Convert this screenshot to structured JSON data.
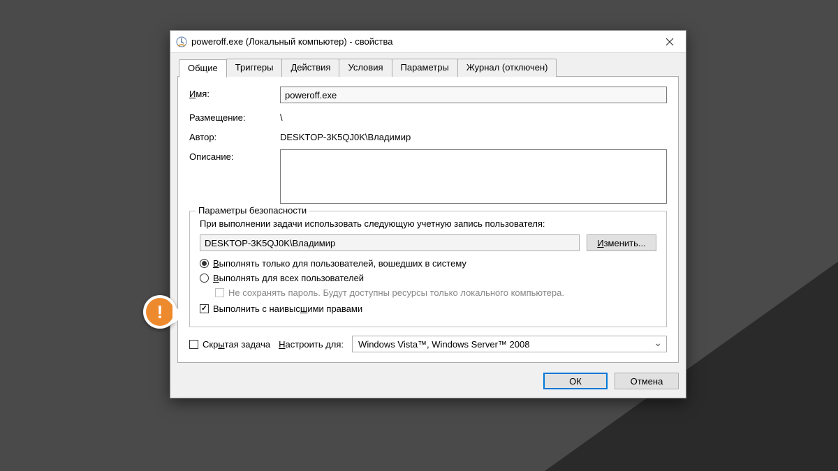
{
  "titlebar": {
    "title": "poweroff.exe (Локальный компьютер) - свойства"
  },
  "tabs": {
    "general": "Общие",
    "triggers": "Триггеры",
    "actions": "Действия",
    "conditions": "Условия",
    "settings": "Параметры",
    "history": "Журнал (отключен)"
  },
  "general": {
    "name_label": "И",
    "name_label2": "мя:",
    "name_value": "poweroff.exe",
    "location_label": "Размещение:",
    "location_value": "\\",
    "author_label": "Автор:",
    "author_value": "DESKTOP-3K5QJ0K\\Владимир",
    "description_label": "Описание:",
    "description_value": ""
  },
  "security": {
    "legend": "Параметры безопасности",
    "run_as_label": "При выполнении задачи использовать следующую учетную запись пользователя:",
    "account_value": "DESKTOP-3K5QJ0K\\Владимир",
    "change_btn_pre": "И",
    "change_btn_post": "зменить...",
    "radio_loggedon_pre": "В",
    "radio_loggedon_post": "ыполнять только для пользователей, вошедших в систему",
    "radio_allusers_pre": "В",
    "radio_allusers_post": "ыполнять для всех пользователей",
    "nosave_pass": "Не сохранять пароль. Будут доступны ресурсы только локального компьютера.",
    "highest_priv_pre": "Выполнить с наивыс",
    "highest_priv_u": "ш",
    "highest_priv_post": "ими правами"
  },
  "bottom": {
    "hidden_pre": "Скр",
    "hidden_u": "ы",
    "hidden_post": "тая задача",
    "configure_pre": "Н",
    "configure_post": "астроить для:",
    "configure_value": "Windows Vista™, Windows Server™ 2008"
  },
  "buttons": {
    "ok": "ОК",
    "cancel": "Отмена"
  },
  "callout": "!"
}
